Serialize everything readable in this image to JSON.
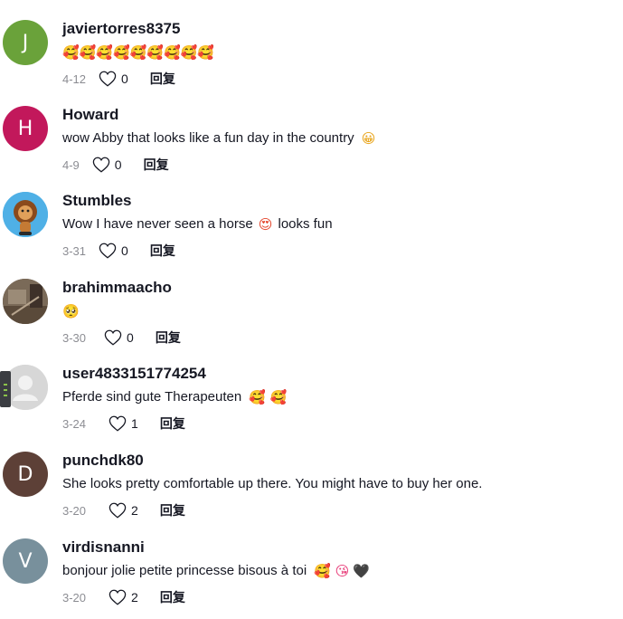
{
  "reply_label": "回复",
  "comments": [
    {
      "username": "javiertorres8375",
      "avatar_letter": "J",
      "avatar_color": "#6aa23a",
      "text": "",
      "emojis": "🥰🥰🥰🥰🥰🥰🥰🥰🥰",
      "date": "4-12",
      "likes": "0"
    },
    {
      "username": "Howard",
      "avatar_letter": "H",
      "avatar_color": "#c2185b",
      "text": "wow Abby that looks like a fun day in the country",
      "emojis": "😀",
      "date": "4-9",
      "likes": "0"
    },
    {
      "username": "Stumbles",
      "avatar_letter": "",
      "avatar_color": "#5ab6e8",
      "text": "Wow I have never seen a horse",
      "emojis": "😍",
      "text_after": " looks fun",
      "date": "3-31",
      "likes": "0"
    },
    {
      "username": "brahimmaacho",
      "avatar_letter": "",
      "avatar_color": "#6b5a48",
      "text": "",
      "emojis": "🥺",
      "date": "3-30",
      "likes": "0"
    },
    {
      "username": "user4833151774254",
      "avatar_letter": "",
      "avatar_color": "#d9d9d9",
      "text": "Pferde sind gute Therapeuten",
      "emojis": "🥰 🥰",
      "date": "3-24",
      "likes": "1"
    },
    {
      "username": "punchdk80",
      "avatar_letter": "D",
      "avatar_color": "#5d4037",
      "text": "She looks pretty comfortable up there. You might have to buy her one.",
      "emojis": "",
      "date": "3-20",
      "likes": "2"
    },
    {
      "username": "virdisnanni",
      "avatar_letter": "V",
      "avatar_color": "#78909c",
      "text": "bonjour jolie petite princesse bisous à toi",
      "emojis": "🥰 😘",
      "emoji_heart": "🖤",
      "date": "3-20",
      "likes": "2"
    }
  ]
}
